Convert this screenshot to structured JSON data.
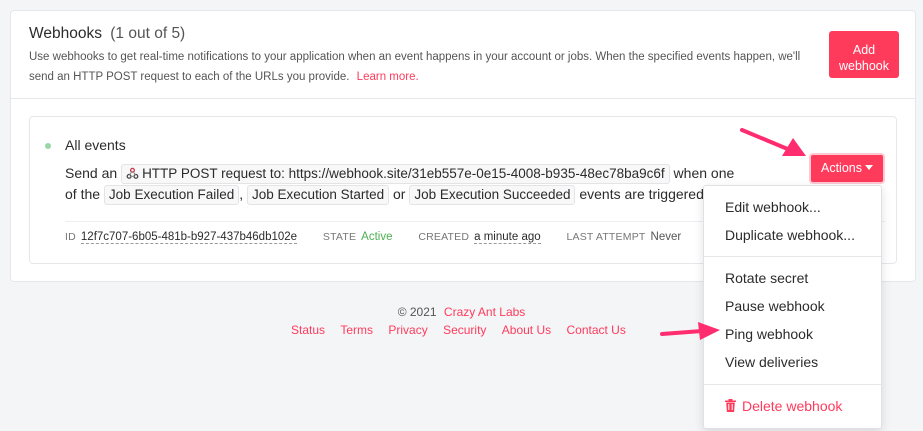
{
  "header": {
    "title": "Webhooks",
    "count": "(1 out of 5)",
    "description": "Use webhooks to get real-time notifications to your application when an event happens in your account or jobs. When the specified events happen, we'll send an HTTP POST request to each of the URLs you provide.",
    "learn_more": "Learn more.",
    "add_button": "Add webhook"
  },
  "webhook": {
    "name": "All events",
    "send_prefix": "Send an",
    "request_text": "HTTP POST request to: https://webhook.site/31eb557e-0e15-4008-b935-48ec78ba9c6f",
    "when_one": "when one",
    "of_the": "of the",
    "events": [
      "Job Execution Failed",
      "Job Execution Started",
      "Job Execution Succeeded"
    ],
    "comma": ",",
    "or": "or",
    "triggered": "events are triggered.",
    "meta": {
      "id_label": "ID",
      "id_value": "12f7c707-6b05-481b-b927-437b46db102e",
      "state_label": "STATE",
      "state_value": "Active",
      "created_label": "CREATED",
      "created_value": "a minute ago",
      "last_attempt_label": "LAST ATTEMPT",
      "last_attempt_value": "Never"
    }
  },
  "actions": {
    "button_label": "Actions",
    "items": {
      "edit": "Edit webhook...",
      "duplicate": "Duplicate webhook...",
      "rotate": "Rotate secret",
      "pause": "Pause webhook",
      "ping": "Ping webhook",
      "deliveries": "View deliveries",
      "delete": "Delete webhook"
    }
  },
  "footer": {
    "copyright": "© 2021",
    "company": "Crazy Ant Labs",
    "links": [
      "Status",
      "Terms",
      "Privacy",
      "Security",
      "About Us",
      "Contact Us"
    ]
  },
  "colors": {
    "accent": "#ff3b5c",
    "active": "#4caf50",
    "arrow": "#ff2d6f"
  }
}
